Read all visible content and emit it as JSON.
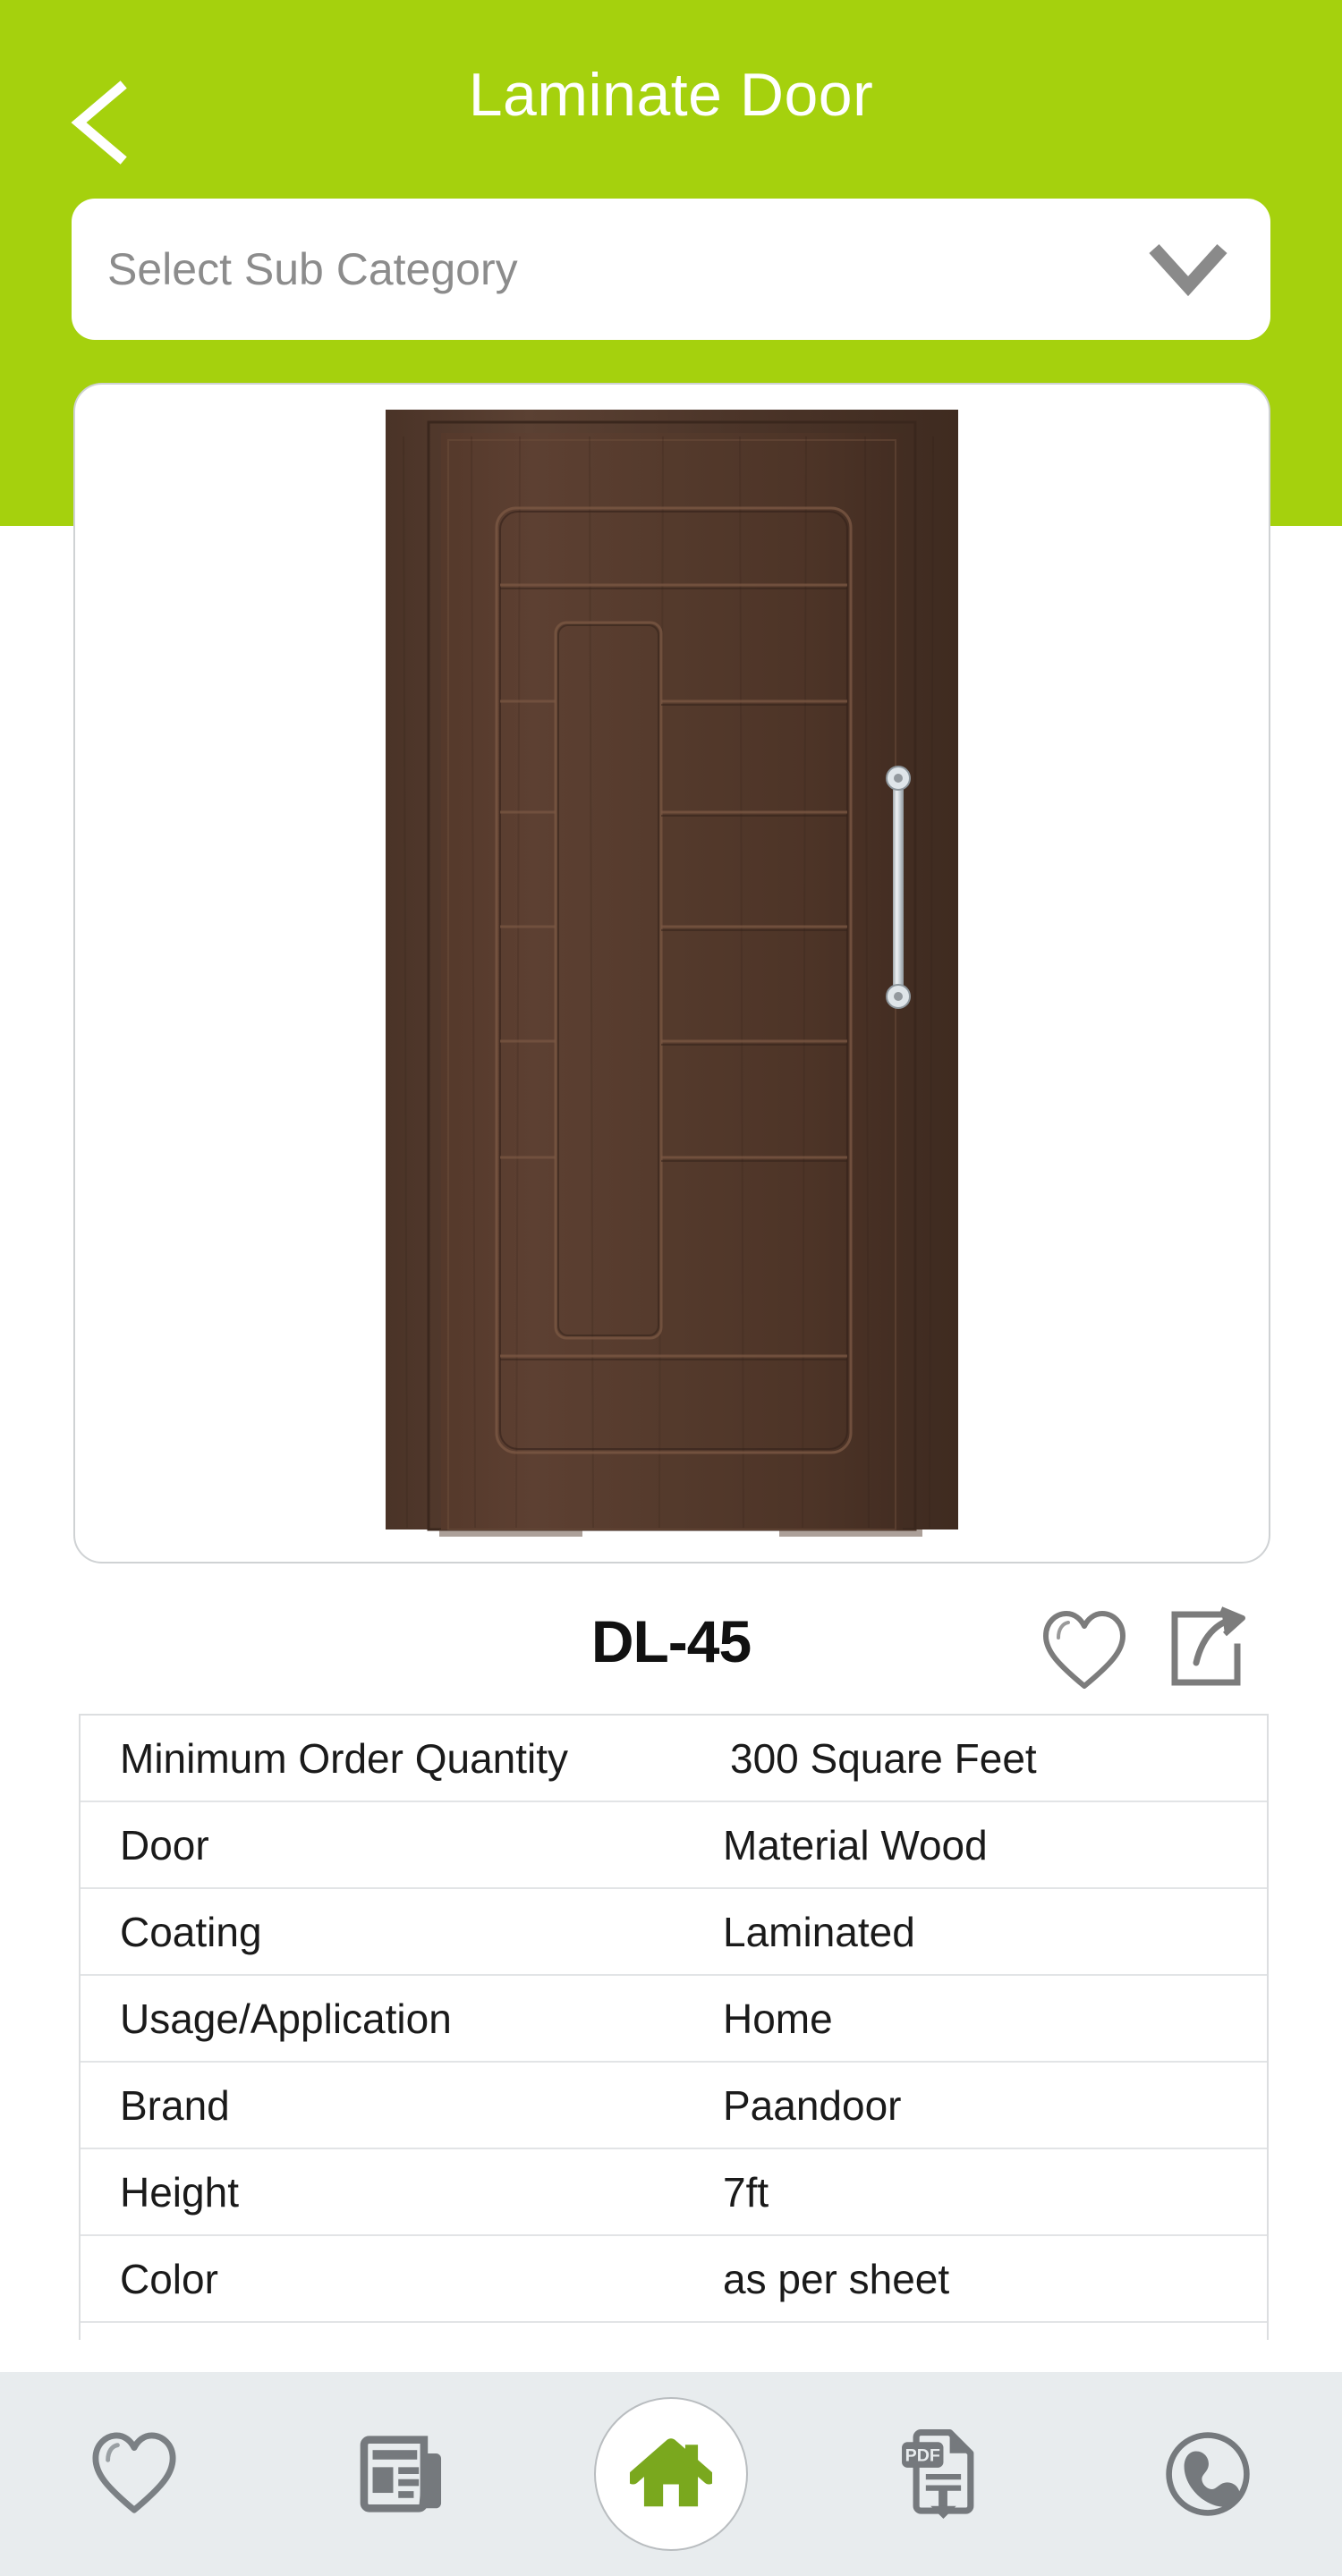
{
  "header": {
    "title": "Laminate Door",
    "back_icon": "chevron-left-icon",
    "background_color": "#a5d10d"
  },
  "sub_category": {
    "placeholder": "Select Sub Category",
    "value": "",
    "chevron_icon": "chevron-down-icon"
  },
  "product": {
    "image_alt": "laminate-door-dark-brown",
    "name": "DL-45",
    "favorite_icon": "heart-icon",
    "share_icon": "share-icon"
  },
  "specs": {
    "rows": [
      {
        "key": "Minimum Order Quantity",
        "value": "300 Square Feet"
      },
      {
        "key": "Door",
        "value": "Material  Wood"
      },
      {
        "key": "Coating",
        "value": "Laminated"
      },
      {
        "key": "Usage/Application",
        "value": "Home"
      },
      {
        "key": "Brand",
        "value": "Paandoor"
      },
      {
        "key": "Height",
        "value": "7ft"
      },
      {
        "key": "Color",
        "value": "as per sheet"
      }
    ]
  },
  "bottom_nav": {
    "background_color": "#e8ecee",
    "active_color": "#7aa81e",
    "items": [
      {
        "icon": "heart-icon",
        "name": "favorites"
      },
      {
        "icon": "news-icon",
        "name": "news"
      },
      {
        "icon": "home-icon",
        "name": "home",
        "active": true
      },
      {
        "icon": "pdf-download-icon",
        "name": "pdf-download",
        "label": "PDF"
      },
      {
        "icon": "phone-icon",
        "name": "call"
      }
    ]
  }
}
